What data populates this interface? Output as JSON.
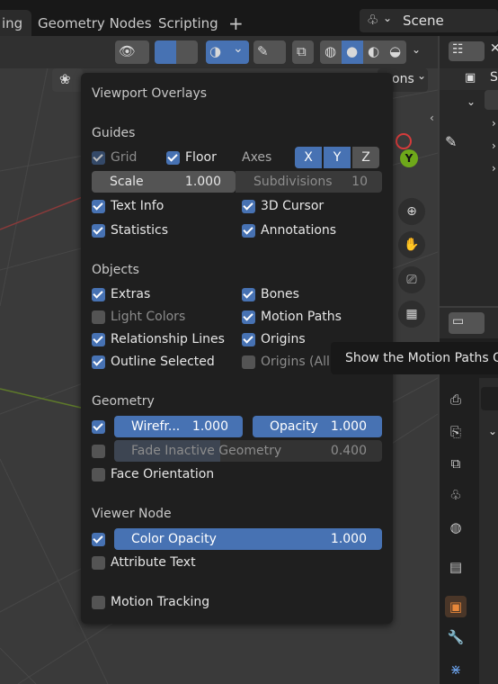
{
  "tabs": [
    "ing",
    "Geometry Nodes",
    "Scripting"
  ],
  "add_tab_label": "+",
  "scene": {
    "label": "Scene"
  },
  "viewport_header": {
    "options_label": "ons"
  },
  "overlay": {
    "title": "Viewport Overlays",
    "guides": {
      "heading": "Guides",
      "grid": "Grid",
      "floor": "Floor",
      "axes": "Axes",
      "axis_x": "X",
      "axis_y": "Y",
      "axis_z": "Z",
      "scale_label": "Scale",
      "scale_value": "1.000",
      "subdivisions_label": "Subdivisions",
      "subdivisions_value": "10",
      "text_info": "Text Info",
      "cursor_3d": "3D Cursor",
      "statistics": "Statistics",
      "annotations": "Annotations"
    },
    "objects": {
      "heading": "Objects",
      "extras": "Extras",
      "bones": "Bones",
      "light_colors": "Light Colors",
      "motion_paths": "Motion Paths",
      "relationship_lines": "Relationship Lines",
      "origins": "Origins",
      "outline_selected": "Outline Selected",
      "origins_all": "Origins (All)"
    },
    "geometry": {
      "heading": "Geometry",
      "wireframe_label": "Wirefr...",
      "wireframe_value": "1.000",
      "opacity_label": "Opacity",
      "opacity_value": "1.000",
      "fade_label": "Fade Inactive Geometry",
      "fade_value": "0.400",
      "face_orientation": "Face Orientation"
    },
    "viewer_node": {
      "heading": "Viewer Node",
      "color_opacity_label": "Color Opacity",
      "color_opacity_value": "1.000",
      "attribute_text": "Attribute Text"
    },
    "motion_tracking": "Motion Tracking"
  },
  "tooltip": {
    "text": "Show the Motion Paths Ov"
  },
  "outliner": {
    "item_label": "S"
  },
  "gizmo": {
    "y_label": "Y"
  },
  "colors": {
    "accent": "#4772b3",
    "panel": "#1f1f1f",
    "gizmo_y": "#6ea81a",
    "gizmo_x": "#d43b3b"
  }
}
